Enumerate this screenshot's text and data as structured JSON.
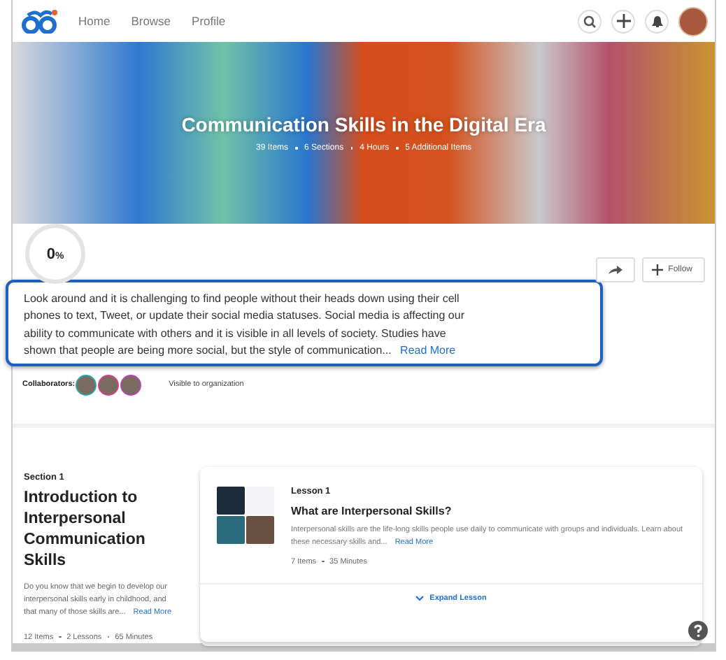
{
  "nav": {
    "links": [
      {
        "label": "Home",
        "selected": false
      },
      {
        "label": "Browse",
        "selected": false
      },
      {
        "label": "Profile",
        "selected": false
      }
    ]
  },
  "hero": {
    "title": "Communication Skills in the Digital Era",
    "stats": [
      "39 Items",
      "6 Sections",
      "4 Hours",
      "5 Additional Items"
    ]
  },
  "progress": {
    "label": "0",
    "unit": "%",
    "level": 0
  },
  "actions": {
    "follow": "Follow"
  },
  "description": {
    "text": "Look around and it is challenging to find people without their heads down using their cell phones to text, Tweet, or update their social media statuses. Social media is affecting our ability to communicate with others and it is visible in all levels of society. Studies have shown that people are being more social, but the style of communication...",
    "link": "Read More"
  },
  "collaborators": {
    "label": "Collaborators:",
    "avatars": [
      {
        "color": "#2aa8a8"
      },
      {
        "color": "#d0458a"
      },
      {
        "color": "#b04ab8"
      }
    ],
    "visibility": "Visible to organization"
  },
  "section": {
    "kicker": "Section 1",
    "title": "Introduction to Interpersonal Communication Skills",
    "text": "Do you know that we begin to develop our interpersonal skills early in childhood, and that many of those skills are...",
    "link": "Read More",
    "stats": [
      "12 Items",
      "2 Lessons",
      "65 Minutes"
    ]
  },
  "lesson": {
    "kicker": "Lesson 1",
    "title": "What are Interpersonal Skills?",
    "text": "Interpersonal skills are the life-long skills people use daily to communicate with groups and individuals. Learn about these necessary skills and...",
    "link": "Read More",
    "stats": [
      "7 Items",
      "35 Minutes"
    ],
    "expand": "Expand Lesson"
  }
}
